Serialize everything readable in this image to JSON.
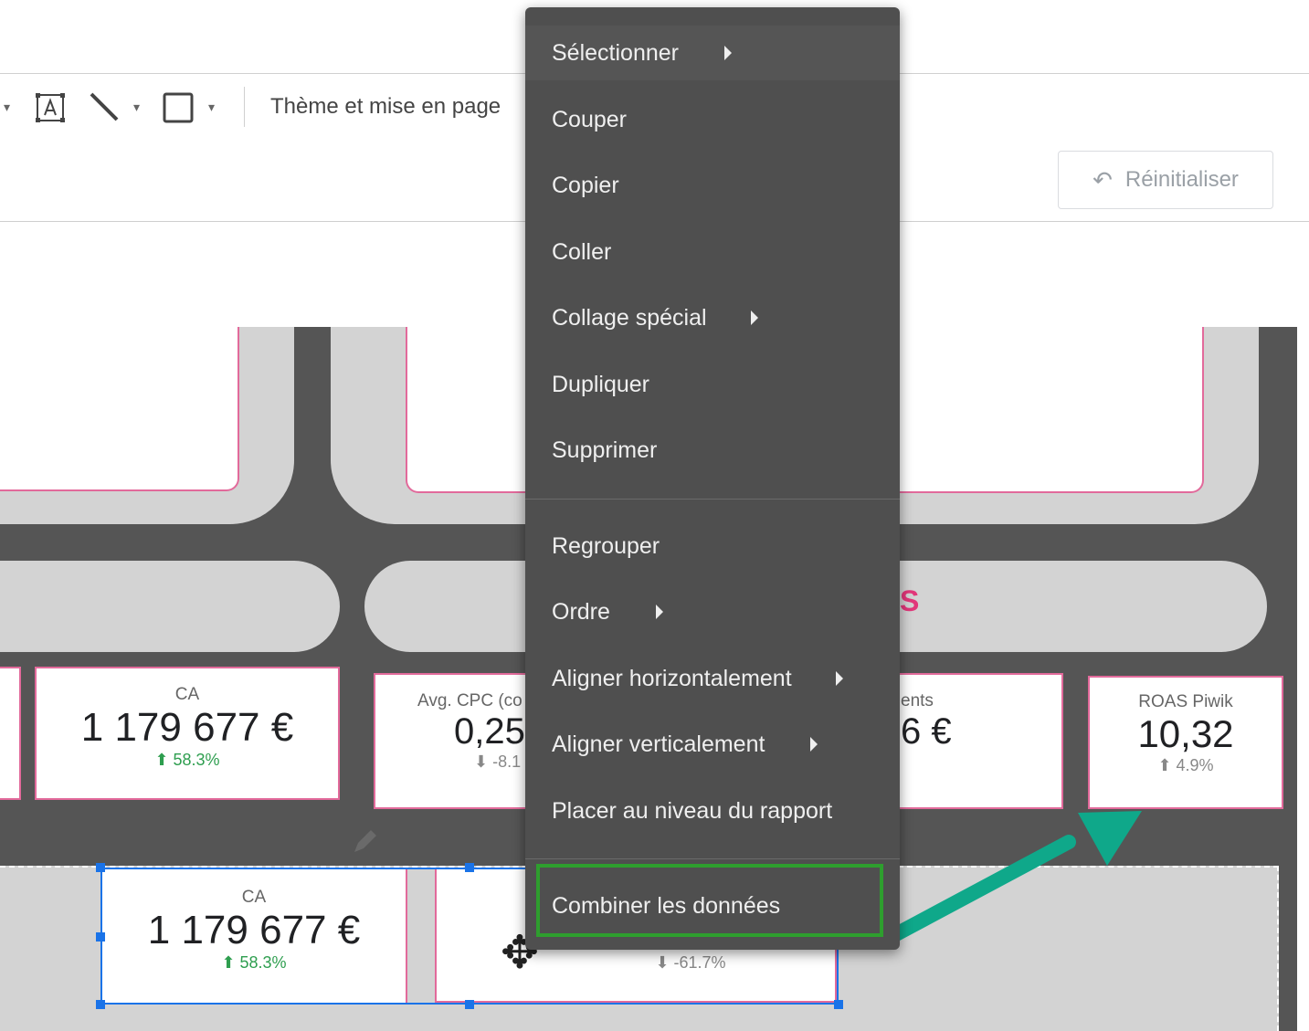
{
  "toolbar": {
    "theme_label": "Thème et mise en page",
    "reset_label": "Réinitialiser"
  },
  "icons": {
    "caret": "▾",
    "undo": "↶",
    "move": "✥"
  },
  "scorecards": [
    {
      "label": "CA",
      "value": "1 179 677 €",
      "delta": "⬆ 58.3%"
    },
    {
      "label": "Avg. CPC (co",
      "value": "0,25",
      "delta": "⬇ -8.1"
    },
    {
      "label": "ents",
      "value": "6 €",
      "delta": ""
    },
    {
      "label": "ROAS Piwik",
      "value": "10,32",
      "delta": "⬆ 4.9%"
    },
    {
      "label": "CA",
      "value": "1 179 677 €",
      "delta": "⬆ 58.3%"
    },
    {
      "label": "",
      "value": "",
      "delta": "⬇ -61.7%"
    }
  ],
  "partial_title": "S",
  "context_menu": {
    "items": [
      {
        "label": "Sélectionner",
        "submenu": true
      },
      {
        "label": "Couper",
        "submenu": false
      },
      {
        "label": "Copier",
        "submenu": false
      },
      {
        "label": "Coller",
        "submenu": false
      },
      {
        "label": "Collage spécial",
        "submenu": true
      },
      {
        "label": "Dupliquer",
        "submenu": false
      },
      {
        "label": "Supprimer",
        "submenu": false
      },
      {
        "label": "Regrouper",
        "submenu": false
      },
      {
        "label": "Ordre",
        "submenu": true
      },
      {
        "label": "Aligner horizontalement",
        "submenu": true
      },
      {
        "label": "Aligner verticalement",
        "submenu": true
      },
      {
        "label": "Placer au niveau du rapport",
        "submenu": false
      },
      {
        "label": "Combiner les données",
        "submenu": false,
        "highlighted": true
      }
    ]
  },
  "colors": {
    "accent_pink": "#e26a9b",
    "highlight_green": "#2e9e2e",
    "arrow_teal": "#0fa88a",
    "selection_blue": "#1a73e8"
  }
}
